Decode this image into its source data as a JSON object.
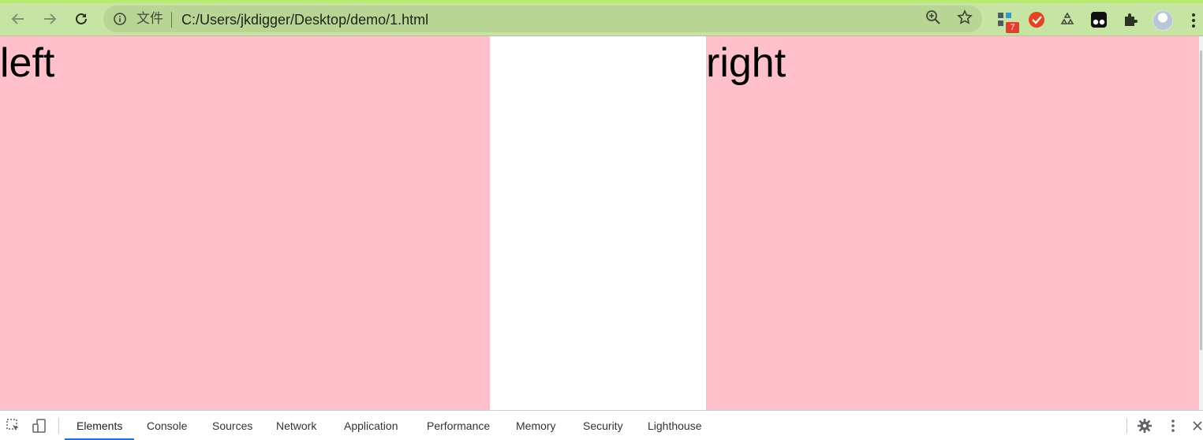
{
  "browser": {
    "omnibox": {
      "scheme_label": "文件",
      "url": "C:/Users/jkdigger/Desktop/demo/1.html"
    },
    "extensions": {
      "badge_count": "7"
    },
    "icons": [
      "back-arrow-icon",
      "forward-arrow-icon",
      "reload-icon",
      "info-icon",
      "zoom-icon",
      "star-icon",
      "extensions-puzzle-icon",
      "recycle-icon",
      "kebab-menu-icon"
    ]
  },
  "page": {
    "left_text": "left",
    "right_text": "right",
    "panel_color": "#ffc0cb",
    "middle_color": "#ffffff"
  },
  "devtools": {
    "tabs": [
      {
        "label": "Elements",
        "active": true
      },
      {
        "label": "Console",
        "active": false
      },
      {
        "label": "Sources",
        "active": false
      },
      {
        "label": "Network",
        "active": false
      },
      {
        "label": "Application",
        "active": false
      },
      {
        "label": "Performance",
        "active": false
      },
      {
        "label": "Memory",
        "active": false
      },
      {
        "label": "Security",
        "active": false
      },
      {
        "label": "Lighthouse",
        "active": false
      }
    ],
    "accent_color": "#1a73e8"
  }
}
